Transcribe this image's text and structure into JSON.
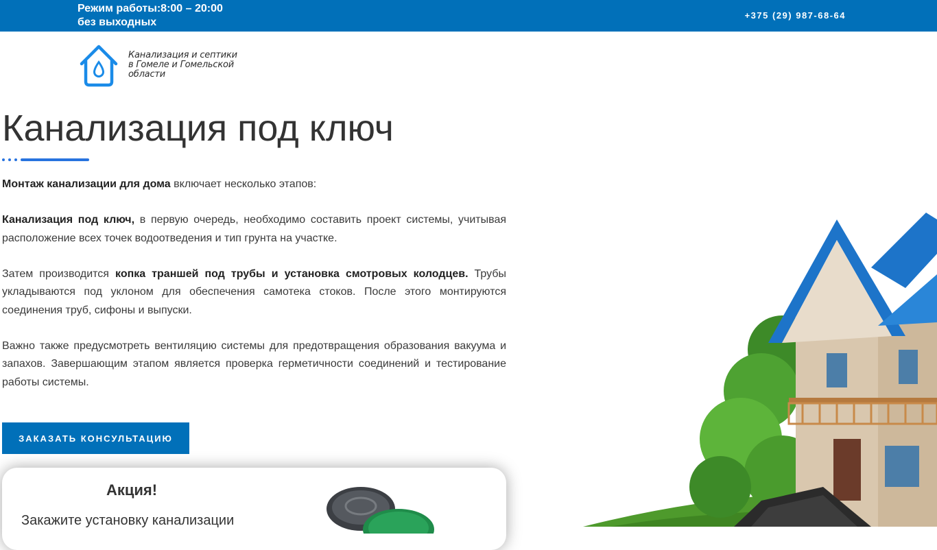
{
  "topbar": {
    "hours_line1": "Режим работы:8:00 – 20:00",
    "hours_line2": "без выходных",
    "phone": "+375 (29) 987-68-64"
  },
  "logo": {
    "line1": "Канализация и септики",
    "line2": "в Гомеле и Гомельской",
    "line3": "области"
  },
  "hero": {
    "title": "Канализация под ключ",
    "p1_bold": "Монтаж канализации для дома",
    "p1_rest": " включает несколько этапов:",
    "p2_bold": "Канализация под ключ,",
    "p2_rest": " в первую очередь, необходимо составить проект системы, учитывая расположение всех точек водоотведения и тип грунта на участке.",
    "p3_start": "Затем производится ",
    "p3_bold": "копка траншей под трубы и установка смотровых колодцев.",
    "p3_rest": " Трубы укладываются под уклоном для обеспечения самотека стоков. После этого монтируются соединения труб, сифоны и выпуски.",
    "p4": " Важно также предусмотреть вентиляцию системы для предотвращения образования вакуума и запахов. Завершающим этапом является проверка герметичности соединений и тестирование работы системы.",
    "cta_label": "ЗАКАЗАТЬ КОНСУЛЬТАЦИЮ"
  },
  "promo": {
    "title": "Акция!",
    "text": "Закажите установку канализации"
  },
  "colors": {
    "brand_blue": "#0170b9",
    "accent_blue": "#2773df"
  },
  "icons": {
    "logo": "house-drop-icon",
    "promo_image": "manhole-covers-icon",
    "hero_image": "house-illustration"
  }
}
